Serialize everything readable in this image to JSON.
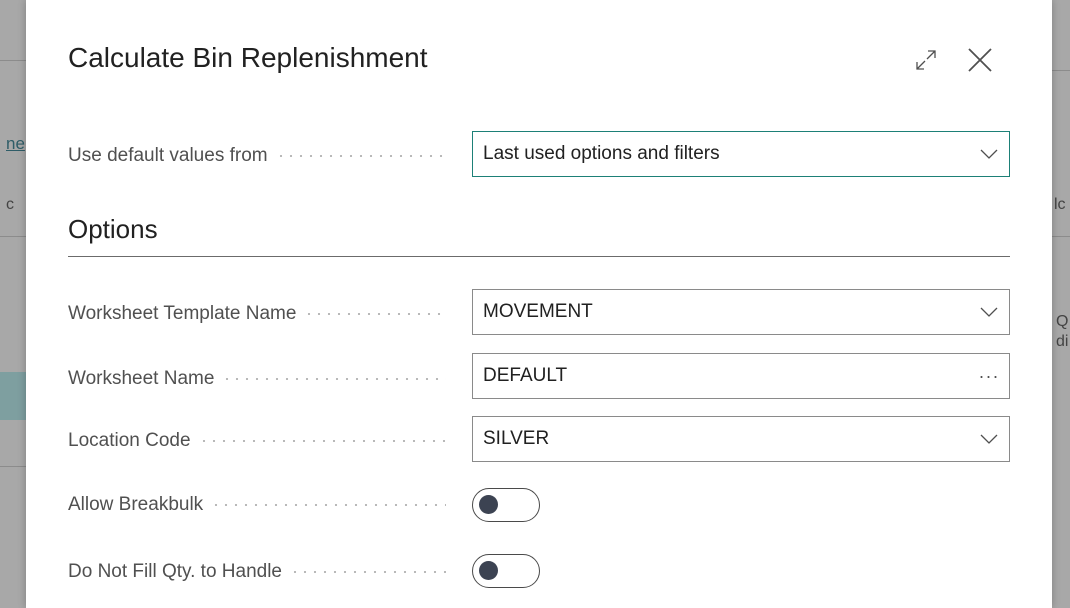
{
  "background": {
    "left_fragment_top": "ne",
    "left_fragment_mid": "c",
    "right_fragment_mid": "lc",
    "right_fragment_lower": "Q\ndi"
  },
  "dialog": {
    "title": "Calculate Bin Replenishment",
    "expand_icon": "expand-icon",
    "close_icon": "close-icon"
  },
  "defaults": {
    "label": "Use default values from",
    "value": "Last used options and filters"
  },
  "options": {
    "section_title": "Options",
    "fields": [
      {
        "label": "Worksheet Template Name",
        "value": "MOVEMENT",
        "control": "dropdown"
      },
      {
        "label": "Worksheet Name",
        "value": "DEFAULT",
        "control": "lookup"
      },
      {
        "label": "Location Code",
        "value": "SILVER",
        "control": "dropdown"
      },
      {
        "label": "Allow Breakbulk",
        "checked": false,
        "control": "toggle"
      },
      {
        "label": "Do Not Fill Qty. to Handle",
        "checked": false,
        "control": "toggle"
      }
    ]
  },
  "colors": {
    "focus_border": "#1d8077",
    "toggle_knob": "#3c4352"
  }
}
